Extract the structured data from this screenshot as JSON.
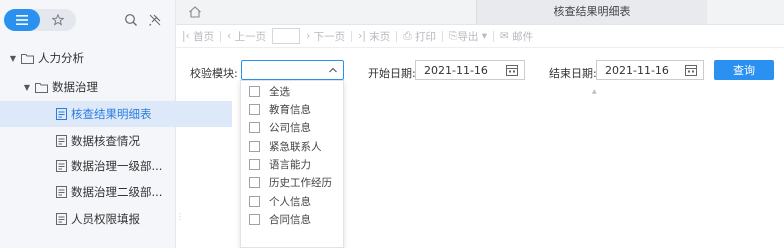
{
  "sidebar": {
    "tree": [
      {
        "label": "人力分析",
        "level": 0,
        "expanded": true,
        "icon": "folder-icon"
      },
      {
        "label": "数据治理",
        "level": 1,
        "expanded": true,
        "icon": "folder-icon"
      },
      {
        "label": "核查结果明细表",
        "level": 2,
        "selected": true,
        "icon": "report-icon"
      },
      {
        "label": "数据核查情况",
        "level": 2,
        "icon": "report-icon"
      },
      {
        "label": "数据治理一级部...",
        "level": 2,
        "icon": "report-icon"
      },
      {
        "label": "数据治理二级部...",
        "level": 2,
        "icon": "report-icon"
      },
      {
        "label": "人员权限填报",
        "level": 2,
        "icon": "report-icon"
      }
    ]
  },
  "tab": {
    "title": "核查结果明细表"
  },
  "toolbar": {
    "first": "首页",
    "prev": "上一页",
    "next": "下一页",
    "last": "末页",
    "print": "打印",
    "export": "导出",
    "email": "邮件"
  },
  "filters": {
    "module_label": "校验模块:",
    "module_value": "",
    "start_label": "开始日期:",
    "start_value": "2021-11-16",
    "end_label": "结束日期:",
    "end_value": "2021-11-16",
    "query_label": "查询"
  },
  "dropdown": {
    "options": [
      "全选",
      "教育信息",
      "公司信息",
      "紧急联系人",
      "语言能力",
      "历史工作经历",
      "个人信息",
      "合同信息"
    ]
  },
  "colors": {
    "accent": "#2a91f0",
    "selected_bg": "#dde9f9",
    "sidebar_bg": "#f4f6f9"
  }
}
